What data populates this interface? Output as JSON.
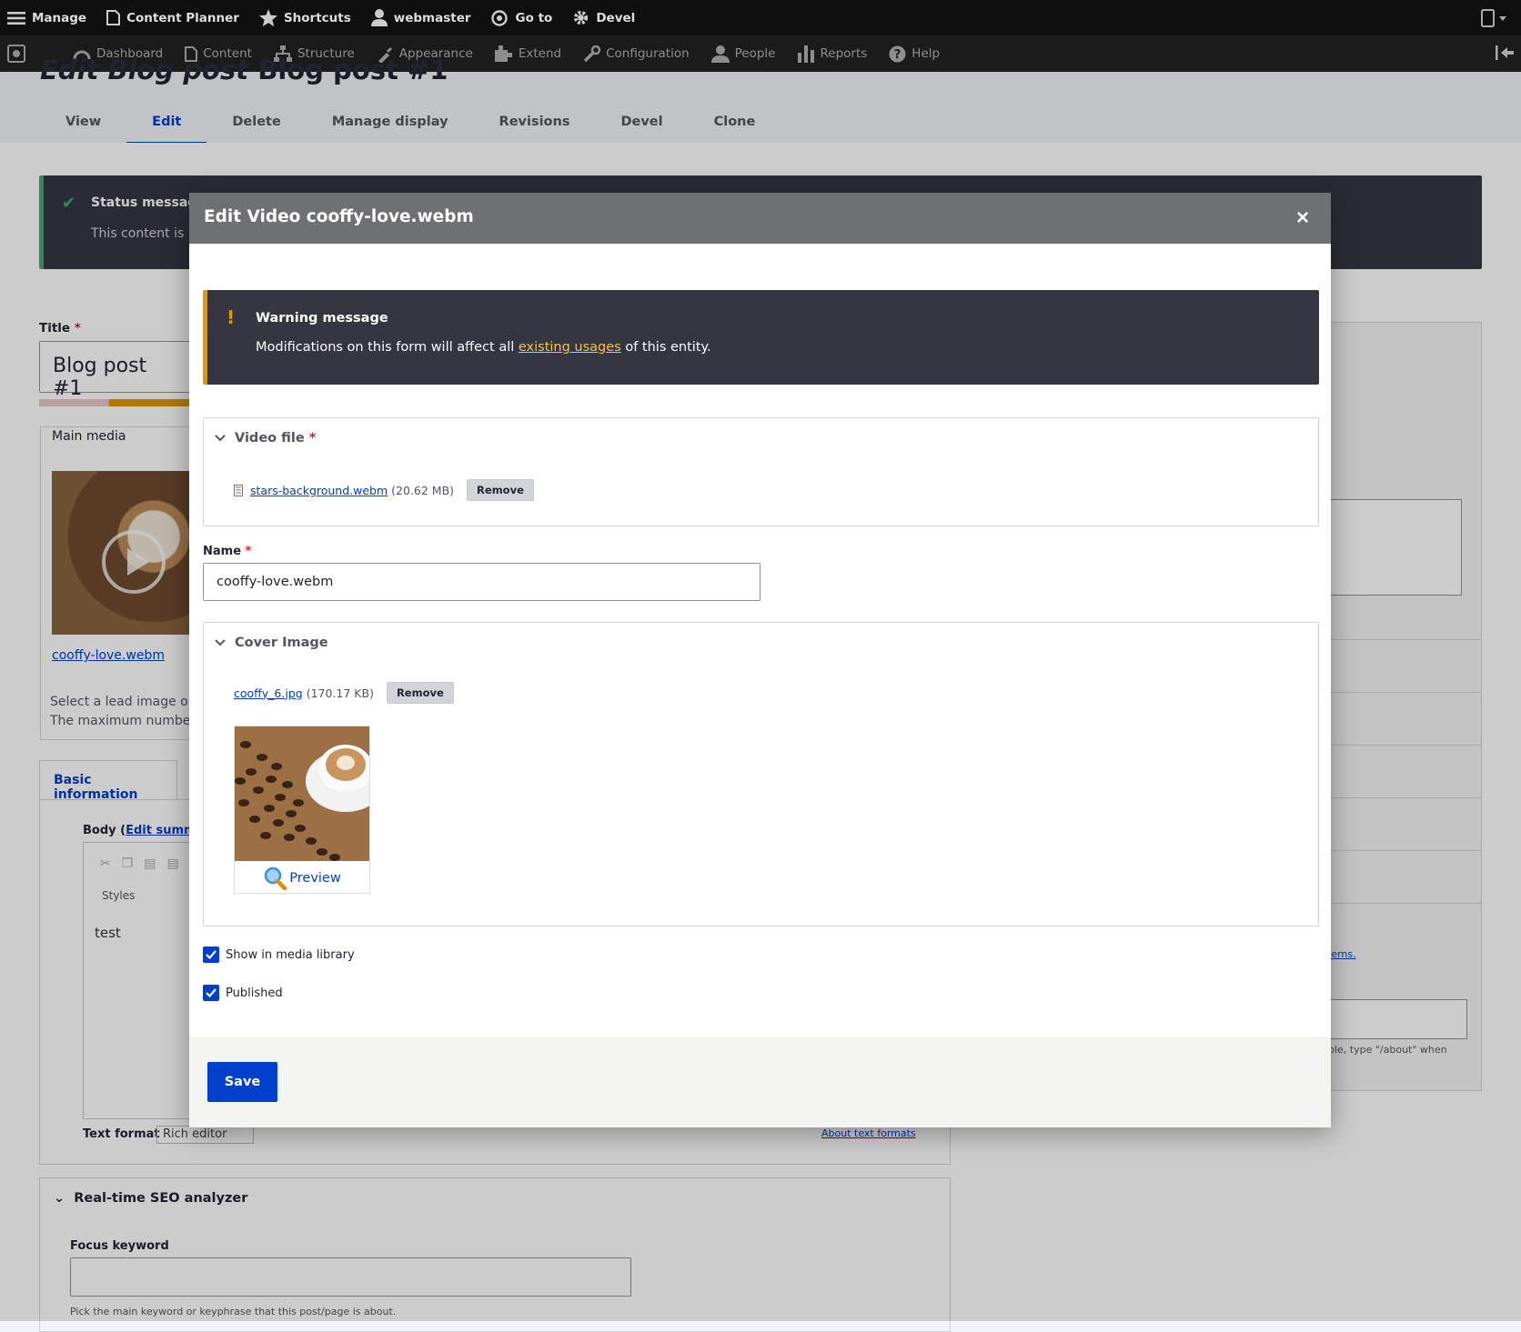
{
  "toolbar": {
    "manage": "Manage",
    "content_planner": "Content Planner",
    "shortcuts": "Shortcuts",
    "user": "webmaster",
    "go_to": "Go to",
    "devel": "Devel"
  },
  "tray": {
    "items": [
      "Dashboard",
      "Content",
      "Structure",
      "Appearance",
      "Extend",
      "Configuration",
      "People",
      "Reports",
      "Help"
    ]
  },
  "page": {
    "title_italic": "Edit Blog post",
    "title_rest": "Blog post #1",
    "tabs": [
      "View",
      "Edit",
      "Delete",
      "Manage display",
      "Revisions",
      "Devel",
      "Clone"
    ],
    "active_tab": "Edit",
    "status_title": "Status message",
    "status_body": "This content is n",
    "title_label": "Title",
    "title_value": "Blog post #1",
    "main_media_legend": "Main media",
    "main_media_link": "cooffy-love.webm",
    "main_media_desc_1": "Select a lead image or v",
    "main_media_desc_2": "The maximum number c",
    "basic_info_tab": "Basic information",
    "body_label": "Body (",
    "edit_summary": "Edit summary",
    "styles_label": "Styles",
    "body_text": "test",
    "text_format_label": "Text format",
    "text_format_value": "Rich editor",
    "about_text_formats": "About text formats",
    "seo_title": "Real-time SEO analyzer",
    "focus_label": "Focus keyword",
    "focus_desc": "Pick the main keyword or keyphrase that this post/page is about.",
    "side_link": "terns.",
    "side_desc": "ple, type \"/about\" when"
  },
  "dialog": {
    "title": "Edit Video cooffy-love.webm",
    "close_label": "×",
    "warning_title": "Warning message",
    "warning_pre": "Modifications on this form will affect all ",
    "warning_link": "existing usages",
    "warning_post": " of this entity.",
    "video_file_legend": "Video file",
    "video_file_name": "stars-background.webm",
    "video_file_size": "(20.62 MB)",
    "remove_label": "Remove",
    "name_label": "Name",
    "name_value": "cooffy-love.webm",
    "cover_legend": "Cover Image",
    "cover_file_name": "cooffy_6.jpg",
    "cover_file_size": "(170.17 KB)",
    "preview_label": "Preview",
    "show_in_library": "Show in media library",
    "show_in_library_checked": true,
    "published": "Published",
    "published_checked": true,
    "save_label": "Save"
  },
  "colors": {
    "accent": "#003ecc",
    "warning": "#e29700",
    "status_ok": "#42a877",
    "dialog_header": "#6f7071"
  },
  "icons": [
    "hamburger-icon",
    "calendar-icon",
    "star-icon",
    "user-icon",
    "goto-icon",
    "gear-icon",
    "device-icon",
    "dashboard-icon",
    "content-icon",
    "structure-icon",
    "appearance-icon",
    "extend-icon",
    "configuration-icon",
    "people-icon",
    "reports-icon",
    "help-icon",
    "collapse-icon",
    "chevron-down-icon",
    "file-icon",
    "magnifier-icon",
    "checkmark-icon"
  ]
}
